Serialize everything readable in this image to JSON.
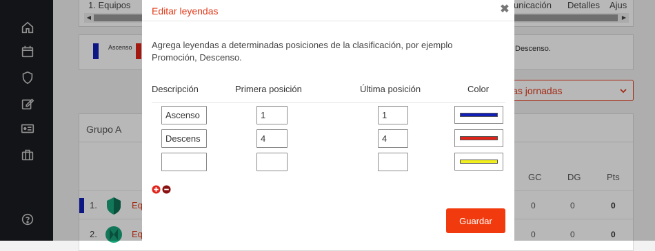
{
  "sidebar": {
    "icons": [
      "home-icon",
      "calendar-icon",
      "shield-icon",
      "edit-icon",
      "id-card-icon",
      "briefcase-icon",
      "help-icon"
    ]
  },
  "background": {
    "tabs": [
      "1. Equipos",
      "unicación",
      "Detalles",
      "Ajus"
    ],
    "legend": {
      "items": [
        {
          "label": "Ascenso",
          "color": "#1320b8"
        },
        {
          "label": "",
          "color": "#e2231a"
        }
      ],
      "trailing_text": "Descenso."
    },
    "round_select": {
      "value": "las jornadas"
    },
    "group": {
      "title": "Grupo A",
      "columns": [
        "GC",
        "DG",
        "Pts"
      ],
      "rows": [
        {
          "rank": "1.",
          "team": "Eq",
          "gc": "0",
          "dg": "0",
          "pts": "0",
          "bar_color": "#1320b8"
        },
        {
          "rank": "2.",
          "team": "Eq",
          "gc": "0",
          "dg": "0",
          "pts": "0"
        }
      ]
    }
  },
  "modal": {
    "title": "Editar leyendas",
    "close": "✖",
    "description": "Agrega leyendas a determinadas posiciones de la clasificación, por ejemplo Promoción, Descenso.",
    "headers": {
      "description": "Descripción",
      "first": "Primera posición",
      "last": "Última posición",
      "color": "Color"
    },
    "rows": [
      {
        "description": "Ascenso",
        "first": "1",
        "last": "1",
        "color": "#1320b8"
      },
      {
        "description": "Descens",
        "first": "4",
        "last": "4",
        "color": "#e2231a"
      },
      {
        "description": "",
        "first": "",
        "last": "",
        "color": "#f1ee20"
      }
    ],
    "save_label": "Guardar",
    "accent": "#f13b0e"
  }
}
